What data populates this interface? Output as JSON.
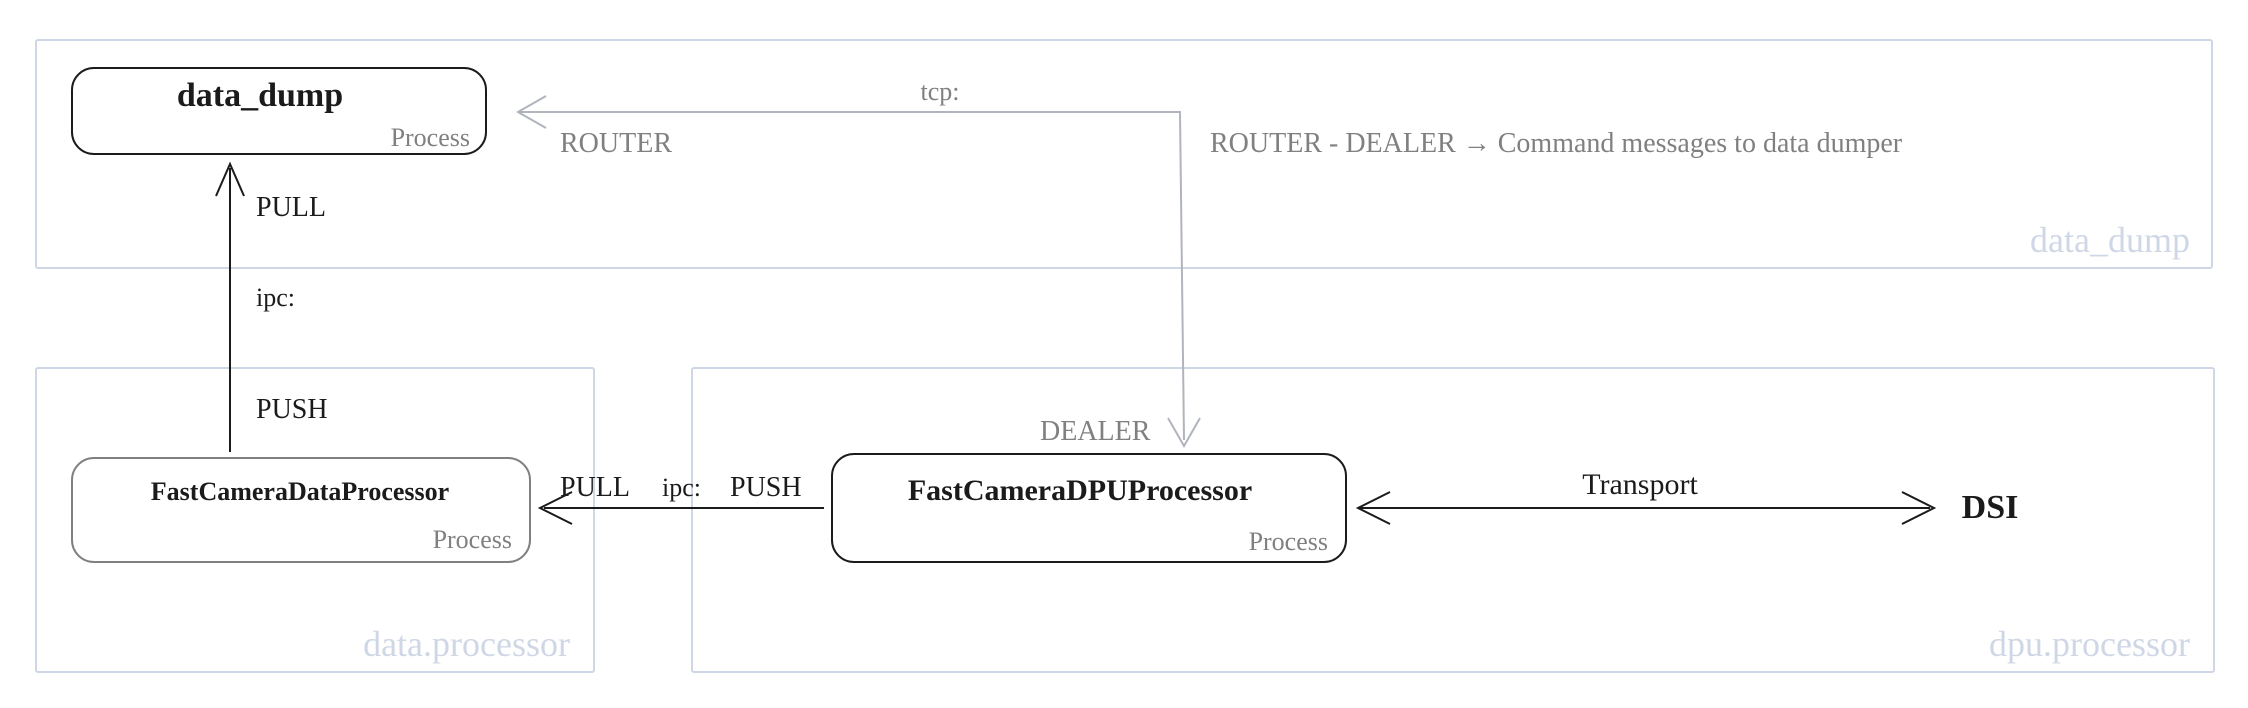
{
  "packages": {
    "data_dump": {
      "label": "data_dump"
    },
    "data_processor": {
      "label": "data.processor"
    },
    "dpu_processor": {
      "label": "dpu.processor"
    }
  },
  "nodes": {
    "data_dump": {
      "title": "data_dump",
      "stereotype": "Process"
    },
    "fast_data": {
      "title": "FastCameraDataProcessor",
      "stereotype": "Process"
    },
    "fast_dpu": {
      "title": "FastCameraDPUProcessor",
      "stereotype": "Process"
    },
    "dsi": {
      "title": "DSI"
    }
  },
  "edges": {
    "router_dealer": {
      "transport": "tcp:",
      "end_left": "ROUTER",
      "end_right": "DEALER",
      "note": "ROUTER - DEALER → Command messages to data dumper"
    },
    "push_pull_vert": {
      "transport": "ipc:",
      "end_top": "PULL",
      "end_bottom": "PUSH"
    },
    "push_pull_horiz": {
      "transport": "ipc:",
      "end_left": "PULL",
      "end_right": "PUSH"
    },
    "transport": {
      "label": "Transport"
    }
  }
}
